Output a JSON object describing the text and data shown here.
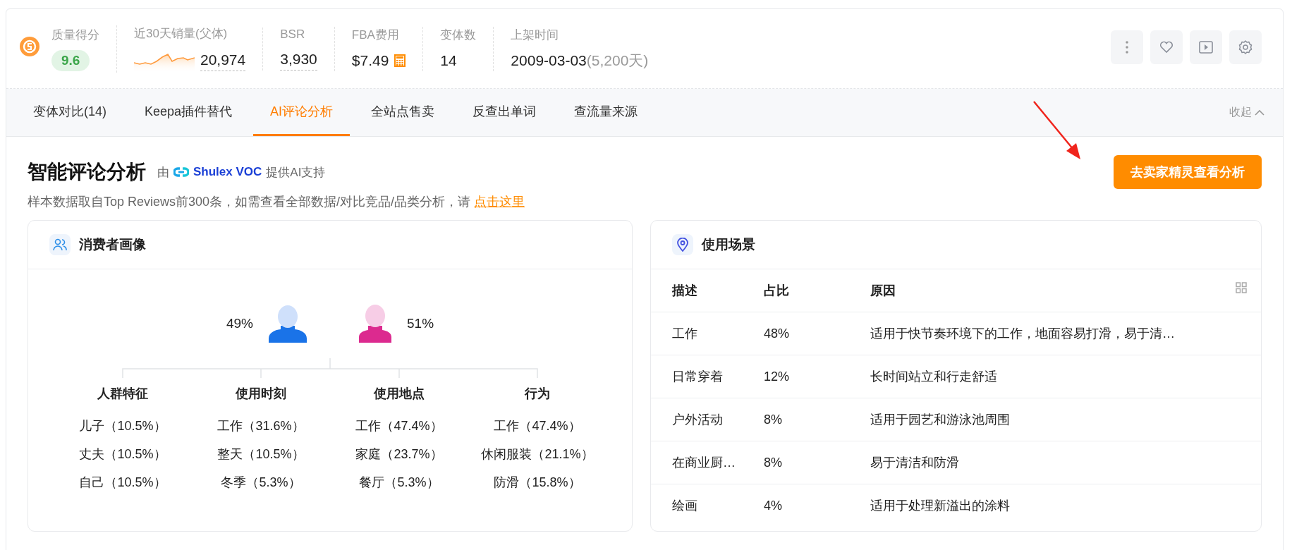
{
  "header": {
    "quality": {
      "label": "质量得分",
      "value": "9.6"
    },
    "stats": [
      {
        "kind": "trend",
        "label": "近30天销量(父体)",
        "value": "20,974"
      },
      {
        "kind": "underlined",
        "label": "BSR",
        "value": "3,930"
      },
      {
        "kind": "fee",
        "label": "FBA费用",
        "value": "$7.49"
      },
      {
        "kind": "plain",
        "label": "变体数",
        "value": "14"
      },
      {
        "kind": "date",
        "label": "上架时间",
        "value": "2009-03-03",
        "note": "(5,200天)"
      }
    ]
  },
  "tabs": [
    {
      "label": "变体对比(14)",
      "selected": false
    },
    {
      "label": "Keepa插件替代",
      "selected": false
    },
    {
      "label": "AI评论分析",
      "selected": true
    },
    {
      "label": "全站点售卖",
      "selected": false
    },
    {
      "label": "反查出单词",
      "selected": false
    },
    {
      "label": "查流量来源",
      "selected": false
    }
  ],
  "collapse": "收起",
  "section": {
    "title": "智能评论分析",
    "provider_prefix": "由",
    "provider": "Shulex VOC",
    "provider_suffix": "提供AI支持",
    "note": "样本数据取自Top Reviews前300条，如需查看全部数据/对比竞品/品类分析，请",
    "link": "点击这里",
    "button": "去卖家精灵查看分析"
  },
  "consumer_profile": {
    "title": "消费者画像",
    "male_share": "49%",
    "female_share": "51%",
    "groups": [
      {
        "heading": "人群特征",
        "items": [
          "儿子（10.5%）",
          "丈夫（10.5%）",
          "自己（10.5%）"
        ]
      },
      {
        "heading": "使用时刻",
        "items": [
          "工作（31.6%）",
          "整天（10.5%）",
          "冬季（5.3%）"
        ]
      },
      {
        "heading": "使用地点",
        "items": [
          "工作（47.4%）",
          "家庭（23.7%）",
          "餐厅（5.3%）"
        ]
      },
      {
        "heading": "行为",
        "items": [
          "工作（47.4%）",
          "休闲服装（21.1%）",
          "防滑（15.8%）"
        ]
      }
    ]
  },
  "usage_scenes": {
    "title": "使用场景",
    "columns": [
      "描述",
      "占比",
      "原因"
    ],
    "rows": [
      {
        "description": "工作",
        "share": "48%",
        "reason": "适用于快节奏环境下的工作，地面容易打滑，易于清…"
      },
      {
        "description": "日常穿着",
        "share": "12%",
        "reason": "长时间站立和行走舒适"
      },
      {
        "description": "户外活动",
        "share": "8%",
        "reason": "适用于园艺和游泳池周围"
      },
      {
        "description": "在商业厨…",
        "share": "8%",
        "reason": "易于清洁和防滑"
      },
      {
        "description": "绘画",
        "share": "4%",
        "reason": "适用于处理新溢出的涂料"
      }
    ]
  }
}
